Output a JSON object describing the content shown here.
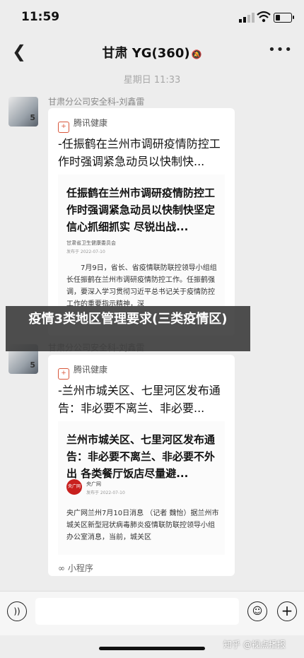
{
  "status_bar": {
    "time": "11:59"
  },
  "nav": {
    "back_icon": "chevron-left-icon",
    "title": "甘肃 YG(360)",
    "mute_icon": "bell-slash-icon",
    "more_icon": "more-dots-icon"
  },
  "timestamp": "星期日 11:33",
  "messages": [
    {
      "sender": "甘肃分公司安全科-刘鑫雷",
      "source": "腾讯健康",
      "title": "-任振鹤在兰州市调研疫情防控工作时强调紧急动员以快制快...",
      "article_title": "任振鹤在兰州市调研疫情防控工作时强调紧急动员以快制快坚定信心抓细抓实 尽锐出战...",
      "article_org": "甘肃省卫生健康委员会",
      "article_date": "发布于 2022-07-10",
      "article_body": "7月9日，省长、省疫情联防联控领导小组组长任振鹤在兰州市调研疫情防控工作。任振鹤强调，要深入学习贯彻习近平总书记关于疫情防控工作的重要指示精神，深"
    },
    {
      "sender": "甘肃分公司安全科-刘鑫雷",
      "source": "腾讯健康",
      "title": "-兰州市城关区、七里河区发布通告：非必要不离兰、非必要...",
      "article_title": "兰州市城关区、七里河区发布通告：非必要不离兰、非必要不外出 各类餐厅饭店尽量避...",
      "logo_text": "央广网",
      "article_org": "央广网",
      "article_date": "发布于 2022-07-10",
      "article_body": "央广网兰州7月10日消息 （记者 魏怡）据兰州市城关区新型冠状病毒肺炎疫情联防联控领导小组办公室消息，当前，城关区",
      "footer": "小程序"
    }
  ],
  "overlay_banner": "疫情3类地区管理要求(三类疫情区)",
  "input_bar": {
    "voice_icon": "voice-icon",
    "emoji_icon": "emoji-icon",
    "plus_icon": "plus-icon"
  },
  "watermark": "知乎 @视点播报"
}
